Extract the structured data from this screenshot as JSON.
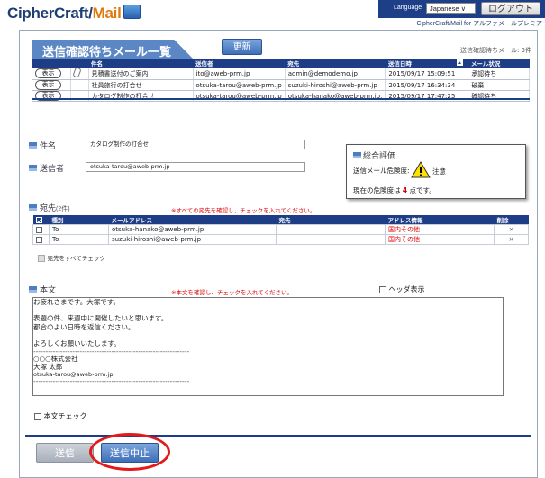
{
  "header": {
    "logo_main": "CipherCraft/",
    "logo_mail": "Mail",
    "language_label": "Language",
    "language_value": "Japanese ∨",
    "logout_label": "ログアウト",
    "user_line": "CipherCraft/Mail for アルファメールプレミア"
  },
  "list": {
    "title": "送信確認待ちメール一覧",
    "refresh_label": "更新",
    "count_text": "送信確認待ちメール: 3件",
    "columns": [
      "",
      "",
      "件名",
      "送信者",
      "宛先",
      "送信日時",
      "",
      "メール状況"
    ],
    "view_label": "表示",
    "rows": [
      {
        "subject": "見積書送付のご案内",
        "sender": "ito@aweb-prm.jp",
        "to": "admin@demodemo.jp",
        "date": "2015/09/17 15:09:51",
        "status": "承認待ち"
      },
      {
        "subject": "社員旅行の打合せ",
        "sender": "otsuka-tarou@aweb-prm.jp",
        "to": "suzuki-hiroshi@aweb-prm.jp",
        "date": "2015/09/17 16:34:34",
        "status": "破棄"
      },
      {
        "subject": "カタログ制作の打合せ",
        "sender": "otsuka-tarou@aweb-prm.jp",
        "to": "otsuka-hanako@aweb-prm.jp,",
        "date": "2015/09/17 17:47:25",
        "status": "確認待ち"
      }
    ]
  },
  "detail": {
    "subject_label": "件名",
    "subject_value": "カタログ制作の打合せ",
    "sender_label": "送信者",
    "sender_value": "otsuka-tarou@aweb-prm.jp",
    "recipients_label": "宛先",
    "recipients_count": "(2件)",
    "recipients_note": "※すべての宛先を確認し、チェックを入れてください。",
    "recipient_columns": [
      "種別",
      "メールアドレス",
      "宛先",
      "アドレス情報",
      "削除"
    ],
    "recipients": [
      {
        "type": "To",
        "email": "otsuka-hanako@aweb-prm.jp",
        "name": "",
        "info": "国内その他",
        "delete": "×"
      },
      {
        "type": "To",
        "email": "suzuki-hiroshi@aweb-prm.jp",
        "name": "",
        "info": "国内その他",
        "delete": "×"
      }
    ],
    "check_all_label": "宛先をすべてチェック",
    "body_label": "本文",
    "body_note": "※本文を確認し、チェックを入れてください。",
    "header_toggle_label": "ヘッダ表示",
    "body_lines": [
      "お疲れさまです。大塚です。",
      "",
      "表題の件、来週中に開催したいと思います。",
      "都合のよい日時を返信ください。",
      "",
      "よろしくお願いいたします。",
      "----------------------------------------------------------------",
      "○○○株式会社",
      "大塚 太郎",
      "otsuka-tarou@aweb-prm.jp",
      "----------------------------------------------------------------"
    ],
    "body_check_label": "本文チェック"
  },
  "evaluation": {
    "title": "総合評価",
    "risk_label": "送信メール危険度:",
    "risk_value": "注意",
    "score_prefix": "現在の危険度は",
    "score_value": "4",
    "score_suffix": "点です。"
  },
  "actions": {
    "send_label": "送信",
    "stop_label": "送信中止"
  },
  "colors": {
    "brand_navy": "#1d3e86",
    "accent_blue": "#5b87c5",
    "warning_red": "#e00000",
    "highlight_circle": "#e21a1a"
  }
}
